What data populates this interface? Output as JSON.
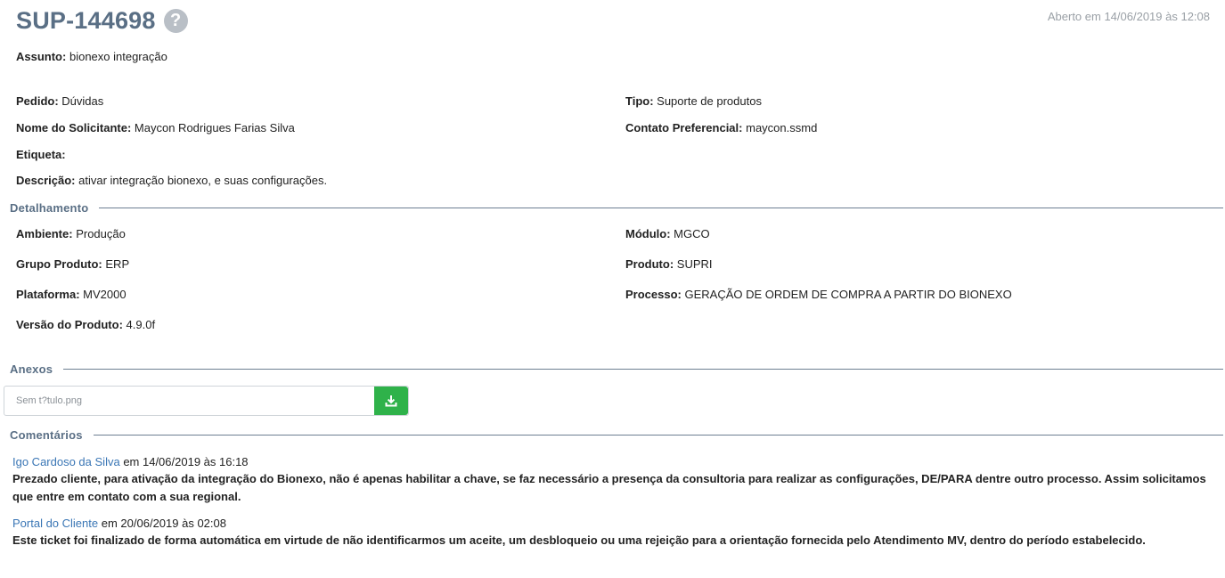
{
  "ticket": {
    "id": "SUP-144698",
    "opened": "Aberto em 14/06/2019 às 12:08"
  },
  "subject": {
    "label": "Assunto:",
    "value": "bionexo integração"
  },
  "fields": {
    "pedido": {
      "label": "Pedido:",
      "value": "Dúvidas"
    },
    "tipo": {
      "label": "Tipo:",
      "value": "Suporte de produtos"
    },
    "solicitante": {
      "label": "Nome do Solicitante:",
      "value": "Maycon Rodrigues Farias Silva"
    },
    "contato": {
      "label": "Contato Preferencial:",
      "value": "maycon.ssmd"
    },
    "etiqueta": {
      "label": "Etiqueta:",
      "value": ""
    },
    "descricao": {
      "label": "Descrição:",
      "value": "ativar integração bionexo, e suas configurações."
    }
  },
  "detalhamento": {
    "title": "Detalhamento",
    "ambiente": {
      "label": "Ambiente:",
      "value": "Produção"
    },
    "modulo": {
      "label": "Módulo:",
      "value": "MGCO"
    },
    "grupo": {
      "label": "Grupo Produto:",
      "value": "ERP"
    },
    "produto": {
      "label": "Produto:",
      "value": "SUPRI"
    },
    "plataforma": {
      "label": "Plataforma:",
      "value": "MV2000"
    },
    "processo": {
      "label": "Processo:",
      "value": "GERAÇÃO DE ORDEM DE COMPRA A PARTIR DO BIONEXO"
    },
    "versao": {
      "label": "Versão do Produto:",
      "value": "4.9.0f"
    }
  },
  "anexos": {
    "title": "Anexos",
    "file": "Sem t?tulo.png"
  },
  "comentarios": {
    "title": "Comentários",
    "items": [
      {
        "author": "Igo Cardoso da Silva",
        "date": "em 14/06/2019 às 16:18",
        "text": "Prezado cliente, para ativação da integração do Bionexo, não é apenas habilitar a chave, se faz necessário a presença da consultoria para realizar as configurações, DE/PARA dentre outro processo. Assim solicitamos que entre em contato com a sua regional."
      },
      {
        "author": "Portal do Cliente",
        "date": "em 20/06/2019 às 02:08",
        "text": "Este ticket foi finalizado de forma automática em virtude de não identificarmos um aceite, um desbloqueio ou uma rejeição para a orientação fornecida pelo Atendimento MV, dentro do período estabelecido."
      }
    ]
  },
  "colors": {
    "title": "#5a6f85",
    "link": "#3a76b5",
    "download": "#2fb24a"
  }
}
